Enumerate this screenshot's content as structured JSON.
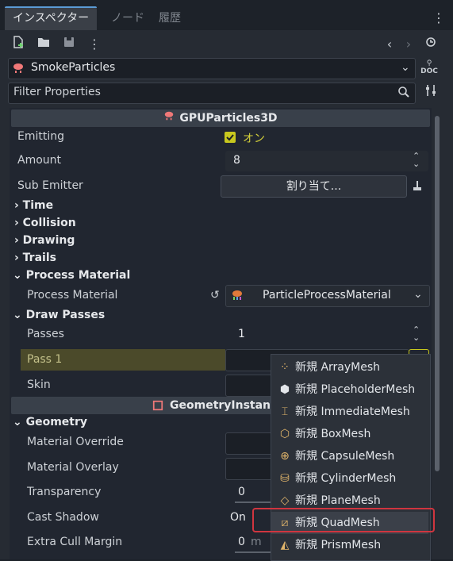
{
  "tabs": {
    "inspector": "インスペクター",
    "node": "ノード",
    "history": "履歴"
  },
  "object": {
    "name": "SmokeParticles"
  },
  "filter": {
    "placeholder": "Filter Properties"
  },
  "header": {
    "class_name": "GPUParticles3D"
  },
  "props": {
    "emitting_label": "Emitting",
    "emitting_value": "オン",
    "amount_label": "Amount",
    "amount_value": "8",
    "sub_emitter_label": "Sub Emitter",
    "sub_emitter_button": "割り当て...",
    "time": "Time",
    "collision": "Collision",
    "drawing": "Drawing",
    "trails": "Trails",
    "process_material_section": "Process Material",
    "process_material_label": "Process Material",
    "process_material_value": "ParticleProcessMaterial",
    "draw_passes_section": "Draw Passes",
    "passes_label": "Passes",
    "passes_value": "1",
    "pass1_label": "Pass 1",
    "skin_label": "Skin",
    "geometry_instance_header": "GeometryInstance3D",
    "geometry_section": "Geometry",
    "material_override_label": "Material Override",
    "material_overlay_label": "Material Overlay",
    "transparency_label": "Transparency",
    "transparency_value": "0",
    "cast_shadow_label": "Cast Shadow",
    "cast_shadow_value": "On",
    "extra_cull_label": "Extra Cull Margin",
    "extra_cull_value": "0",
    "extra_cull_unit": "m"
  },
  "menu": {
    "items": [
      {
        "label": "新規 ArrayMesh",
        "icon": "array-mesh-icon"
      },
      {
        "label": "新規 PlaceholderMesh",
        "icon": "placeholder-mesh-icon"
      },
      {
        "label": "新規 ImmediateMesh",
        "icon": "immediate-mesh-icon"
      },
      {
        "label": "新規 BoxMesh",
        "icon": "box-mesh-icon"
      },
      {
        "label": "新規 CapsuleMesh",
        "icon": "capsule-mesh-icon"
      },
      {
        "label": "新規 CylinderMesh",
        "icon": "cylinder-mesh-icon"
      },
      {
        "label": "新規 PlaneMesh",
        "icon": "plane-mesh-icon"
      },
      {
        "label": "新規 QuadMesh",
        "icon": "quad-mesh-icon"
      },
      {
        "label": "新規 PrismMesh",
        "icon": "prism-mesh-icon"
      }
    ],
    "highlighted_index": 7
  },
  "colors": {
    "accent": "#5b9bd5",
    "particles_icon": "#f07878",
    "checkbox": "#c8c81e",
    "selection_row": "#4b4a2a",
    "highlight_box": "#d0353f",
    "menu_icon": "#e0b46a"
  }
}
